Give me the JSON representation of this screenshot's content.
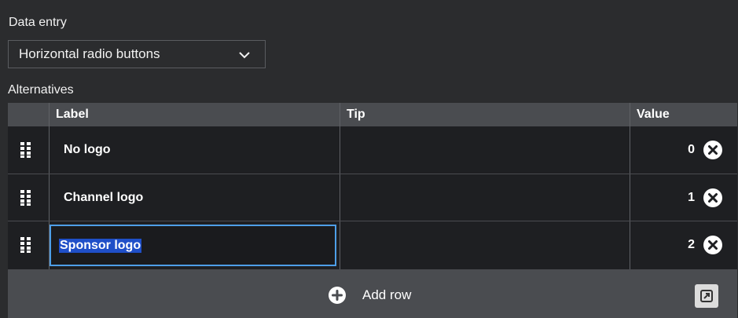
{
  "data_entry": {
    "label": "Data entry",
    "selected": "Horizontal radio buttons"
  },
  "alternatives": {
    "label": "Alternatives",
    "columns": [
      "Label",
      "Tip",
      "Value"
    ],
    "rows": [
      {
        "label": "No logo",
        "tip": "",
        "value": "0"
      },
      {
        "label": "Channel logo",
        "tip": "",
        "value": "1"
      },
      {
        "label": "Sponsor logo",
        "tip": "",
        "value": "2"
      }
    ],
    "add_row_label": "Add row"
  },
  "icons": {
    "dropdown": "chevron-down-icon",
    "drag": "drag-handle-icon",
    "delete": "close-circle-icon",
    "add": "plus-circle-icon",
    "expand": "expand-icon"
  },
  "colors": {
    "background": "#2b2c2e",
    "header": "#4a4c50",
    "table_body": "#1e1f22",
    "focus": "#4e9fe8",
    "selection": "#1f4fc8"
  }
}
